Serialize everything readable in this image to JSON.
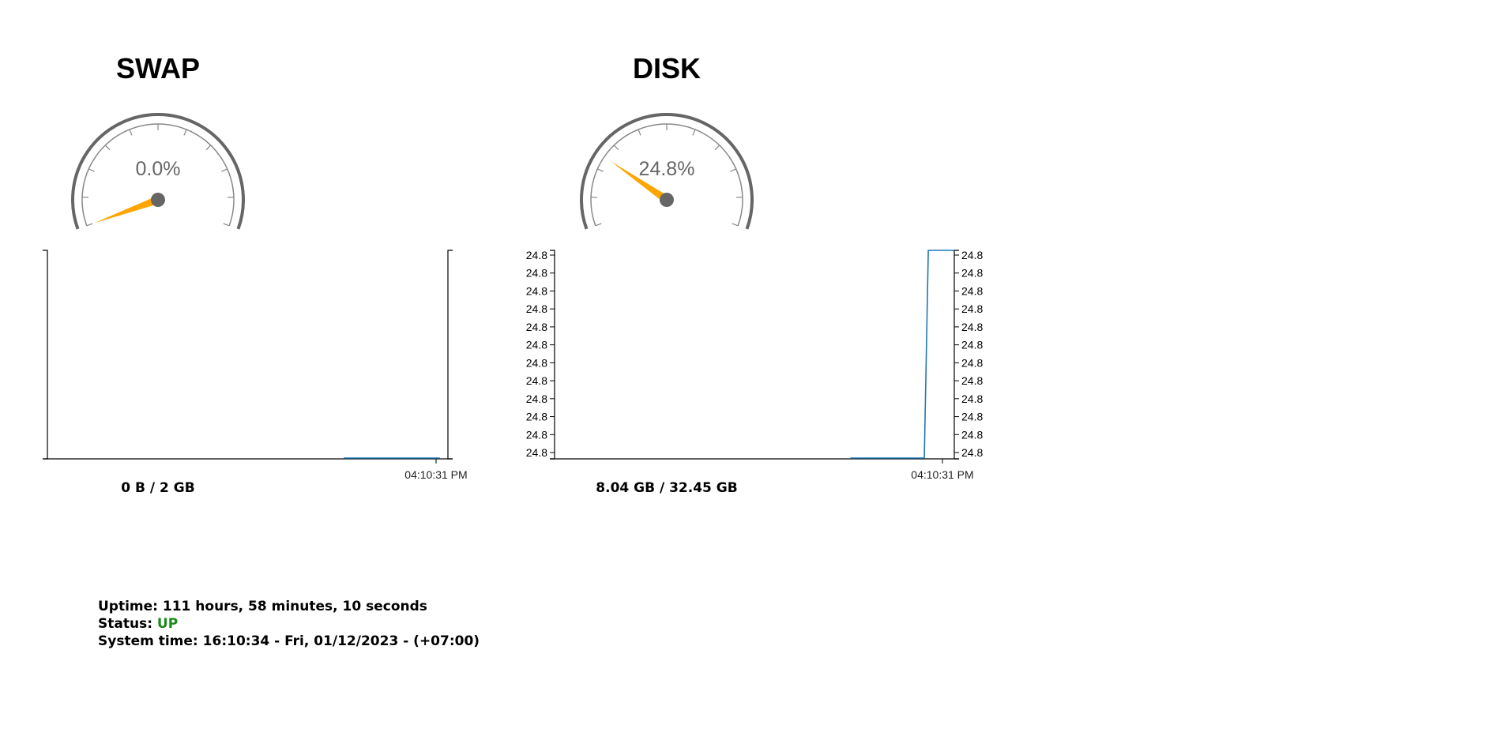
{
  "panels": [
    {
      "id": "swap",
      "title": "SWAP",
      "gauge": {
        "percent": 0.0,
        "label": "0.0%"
      },
      "chart": {
        "time_label": "04:10:31 PM",
        "y_ticks": [],
        "series": [
          {
            "t": 0.74,
            "v": 0
          },
          {
            "t": 0.98,
            "v": 0
          }
        ]
      },
      "usage": "0 B / 2 GB"
    },
    {
      "id": "disk",
      "title": "DISK",
      "gauge": {
        "percent": 24.8,
        "label": "24.8%"
      },
      "chart": {
        "time_label": "04:10:31 PM",
        "y_ticks": [
          "24.8",
          "24.8",
          "24.8",
          "24.8",
          "24.8",
          "24.8",
          "24.8",
          "24.8",
          "24.8",
          "24.8",
          "24.8",
          "24.8"
        ],
        "series": [
          {
            "t": 0.74,
            "v": 0
          },
          {
            "t": 0.925,
            "v": 0
          },
          {
            "t": 0.935,
            "v": 1
          },
          {
            "t": 1.0,
            "v": 1
          }
        ]
      },
      "usage": "8.04 GB / 32.45 GB"
    }
  ],
  "system": {
    "uptime_label": "Uptime:",
    "uptime_value": "111 hours, 58 minutes, 10 seconds",
    "status_label": "Status:",
    "status_value": "UP",
    "time_label": "System time:",
    "time_value": "16:10:34 - Fri, 01/12/2023 - (+07:00)"
  },
  "colors": {
    "needle": "#ffa500",
    "gauge_outer": "#666666",
    "gauge_inner": "#888888",
    "line": "#1f77b4",
    "status_up": "#1a8a1a"
  }
}
